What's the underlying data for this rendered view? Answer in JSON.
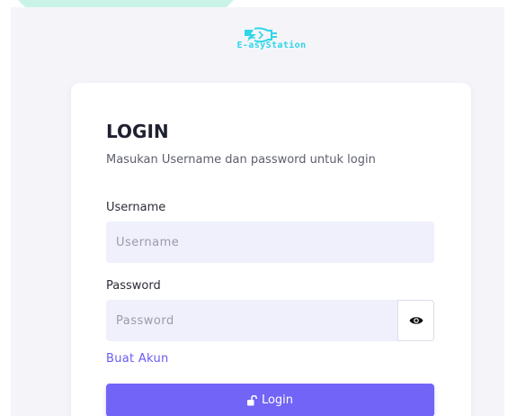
{
  "brand": {
    "logo_text": "E-asyStation",
    "logo_icon": "lightning-plug-icon",
    "accent_color": "#2fd6e9"
  },
  "login_card": {
    "title": "LOGIN",
    "subtitle": "Masukan Username dan password untuk login",
    "username": {
      "label": "Username",
      "placeholder": "Username",
      "value": ""
    },
    "password": {
      "label": "Password",
      "placeholder": "Password",
      "value": "",
      "toggle_icon": "eye-icon"
    },
    "create_account_link": "Buat Akun",
    "login_button": {
      "label": "Login",
      "icon": "unlock-icon",
      "color": "#7264f6"
    }
  },
  "colors": {
    "background": "#f5f5f9",
    "input_background": "#eff0fc",
    "link": "#6a5bf0"
  }
}
